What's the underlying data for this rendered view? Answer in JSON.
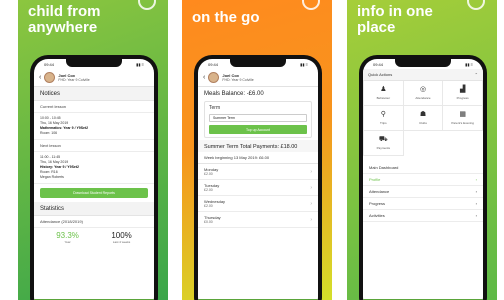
{
  "panels": [
    {
      "headline": "child from\nanywhere",
      "status": {
        "time": "09:44",
        "signal": "▮▮ ≡"
      },
      "profile": {
        "name": "Joel Cox",
        "sub": "FHD: Year 9 Colville"
      },
      "notices_title": "Notices",
      "current_label": "Current lesson",
      "current_lesson": {
        "time": "10:00 - 10:45",
        "date": "Thu, 16 May 2019",
        "subject": "Mathematics: Year 9 / Y9Set2",
        "room": "Room: 106"
      },
      "next_label": "Next lesson",
      "next_lesson": {
        "time": "11:00 - 11:45",
        "date": "Thu, 16 May 2019",
        "subject": "History: Year 9 / Y9Set2",
        "room": "Room: R16",
        "teacher": "Megan Roberts"
      },
      "report_button": "Download Student Reports",
      "stats_title": "Statistics",
      "attendance_label": "Attendance (2018/2019)",
      "stat_1": {
        "value": "93.3%",
        "caption": "Year"
      },
      "stat_2": {
        "value": "100%",
        "caption": "Last 4 weeks"
      }
    },
    {
      "headline": "on the go",
      "status": {
        "time": "09:44",
        "signal": "▮▮ ≡"
      },
      "profile": {
        "name": "Joel Cox",
        "sub": "FHD: Year 9 Colville"
      },
      "balance": "Meals Balance: -£6.00",
      "term_title": "Term",
      "term_value": "Summer Term",
      "topup_button": "Top up Account",
      "total": "Summer Term Total Payments: £18.00",
      "week": "Week beginning 13 May 2019: £6.00",
      "days": [
        {
          "name": "Monday",
          "amount": "£2.00"
        },
        {
          "name": "Tuesday",
          "amount": "£2.00"
        },
        {
          "name": "Wednesday",
          "amount": "£2.00"
        },
        {
          "name": "Thursday",
          "amount": "£0.00"
        }
      ]
    },
    {
      "headline": "info in one\nplace",
      "status": {
        "time": "09:44",
        "signal": "▮▮ ≡"
      },
      "quick_actions": "Quick Actions",
      "tiles": [
        {
          "label": "Behaviour",
          "icon": "person-icon"
        },
        {
          "label": "Attendance",
          "icon": "target-icon"
        },
        {
          "label": "Progress",
          "icon": "podium-icon"
        },
        {
          "label": "Trips",
          "icon": "pin-icon"
        },
        {
          "label": "Clubs",
          "icon": "group-icon"
        },
        {
          "label": "Parent's Evening",
          "icon": "calendar-icon"
        },
        {
          "label": "Payments",
          "icon": "cart-icon"
        }
      ],
      "menu": [
        {
          "label": "Main Dashboard",
          "active": false
        },
        {
          "label": "Profile",
          "active": true
        },
        {
          "label": "Attendance",
          "active": false
        },
        {
          "label": "Progress",
          "active": false
        },
        {
          "label": "Activities",
          "active": false
        }
      ]
    }
  ],
  "tabbar": {
    "left": "≡",
    "right": "●"
  }
}
